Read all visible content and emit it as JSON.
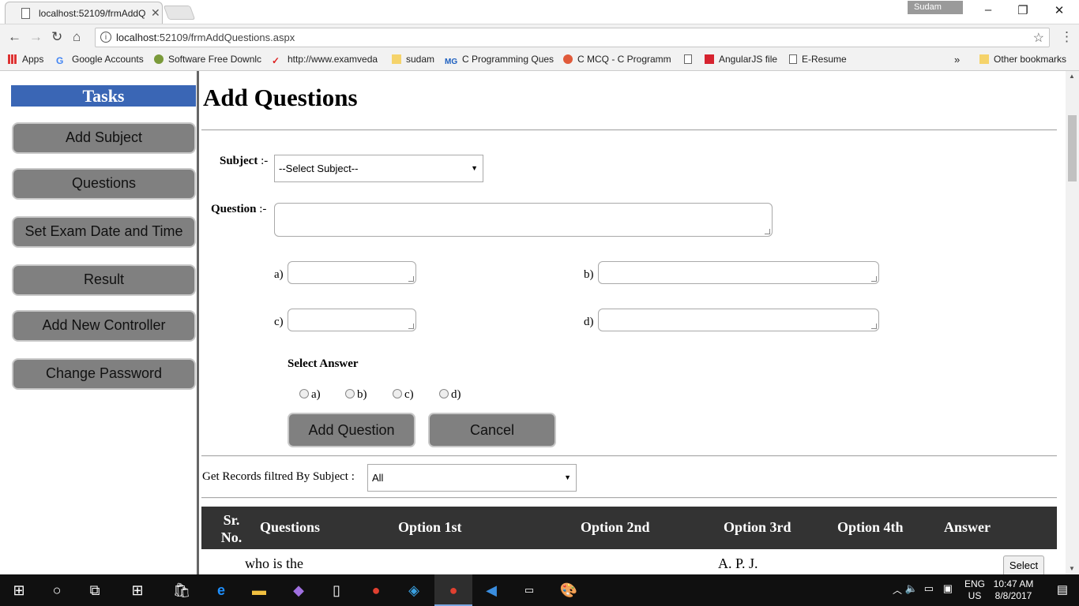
{
  "browser": {
    "tab_title": "localhost:52109/frmAddQ",
    "user_name": "Sudam",
    "url_host": "localhost",
    "url_rest": ":52109/frmAddQuestions.aspx",
    "bookmarks": [
      "Apps",
      "Google Accounts",
      "Software Free Downlc",
      "http://www.examveda",
      "sudam",
      "C Programming Ques",
      "C MCQ - C Programm",
      "",
      "AngularJS file",
      "E-Resume"
    ],
    "more_label": "»",
    "other_bookmarks": "Other bookmarks"
  },
  "sidebar": {
    "heading": "Tasks",
    "items": [
      "Add Subject",
      "Questions",
      "Set Exam Date and Time",
      "Result",
      "Add New Controller",
      "Change Password"
    ]
  },
  "form": {
    "title": "Add Questions",
    "subject_label": "Subject",
    "subject_sep": " :-",
    "subject_value": "--Select Subject--",
    "question_label": "Question",
    "question_sep": " :-",
    "option_labels": [
      "a)",
      "b)",
      "c)",
      "d)"
    ],
    "select_answer_label": "Select Answer",
    "answers": [
      "a)",
      "b)",
      "c)",
      "d)"
    ],
    "add_button": "Add Question",
    "cancel_button": "Cancel"
  },
  "filter": {
    "label": "Get Records filtred By Subject :",
    "value": "All"
  },
  "grid": {
    "headers": [
      "Sr. No.",
      "Questions",
      "Option 1st",
      "Option 2nd",
      "Option 3rd",
      "Option 4th",
      "Answer"
    ],
    "row1": {
      "question": "who is the",
      "option3": "A. P. J.",
      "select": "Select"
    }
  },
  "taskbar": {
    "lang1": "ENG",
    "lang2": "US",
    "time": "10:47 AM",
    "date": "8/8/2017"
  }
}
